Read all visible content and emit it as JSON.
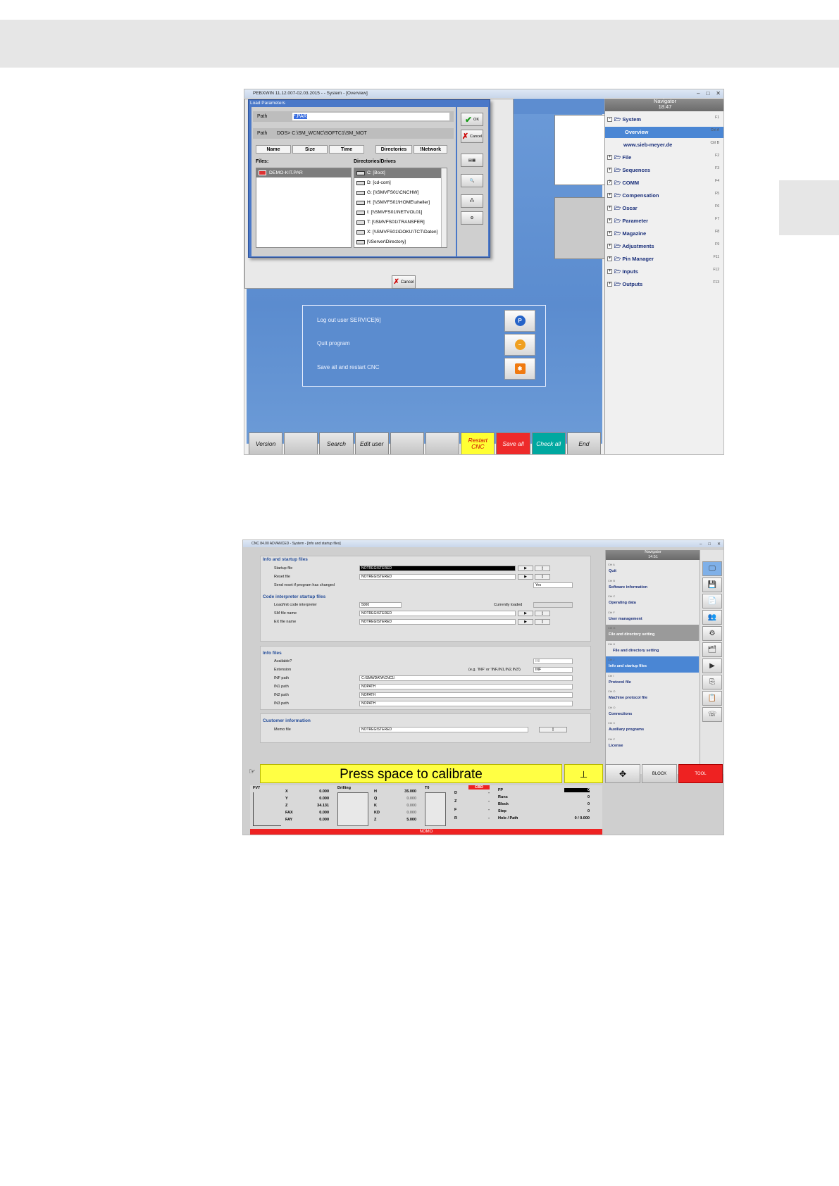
{
  "shot1": {
    "window_title": "PEBXWIN 11.12.007-02.03.2015 -  - System - [Overview]",
    "dialog": {
      "title": "Load Parameters",
      "path_label": "Path",
      "path_value": "*.PAR",
      "dos_label": "Path",
      "dos_value": "DOS> C:\\SM_WCNC\\SOFTC1\\SM_MOT",
      "columns": [
        "Name",
        "Size",
        "Time",
        "Directories",
        "!Network"
      ],
      "files_label": "Files:",
      "drives_label": "Directories/Drives",
      "files": [
        "DEMO-KIT.PAR"
      ],
      "drives": [
        "C: [Boot]",
        "D: [cd-com]",
        "G: [\\\\SMVFS01\\CNCHW]",
        "H: [\\\\SMVFS01\\HOME\\uheller]",
        "I: [\\\\SMVFS01\\NETVOL01]",
        "T: [\\\\SMVFS01\\TRANSFER]",
        "X: [\\\\SMVFS01\\DOKU\\TCT\\Daten]",
        "[\\\\Server\\Directory]"
      ],
      "ok_label": "OK",
      "cancel_label": "Cancel",
      "outer_cancel_label": "Cancel"
    },
    "panel": {
      "logout": "Log out user SERVICE[6]",
      "quit": "Quit program",
      "save": "Save all and restart CNC"
    },
    "fkeys": [
      "Version",
      "",
      "Search",
      "Edit user",
      "",
      "",
      "Restart CNC",
      "Save all",
      "Check all",
      "End"
    ],
    "fkey_colors": [
      "",
      "",
      "",
      "",
      "",
      "",
      "#ffff33",
      "#ee2a2a",
      "#00a8a0",
      ""
    ],
    "navigator": {
      "title": "Navigator",
      "time": "18:47",
      "items": [
        {
          "label": "System",
          "key": "F1",
          "type": "folder",
          "exp": "-"
        },
        {
          "label": "Overview",
          "key": "Ctrl A",
          "type": "selected",
          "exp": ""
        },
        {
          "label": "www.sieb-meyer.de",
          "key": "Ctrl B",
          "type": "link",
          "exp": ""
        },
        {
          "label": "File",
          "key": "F2",
          "type": "folder",
          "exp": "+"
        },
        {
          "label": "Sequences",
          "key": "F3",
          "type": "folder",
          "exp": "+"
        },
        {
          "label": "COMM",
          "key": "F4",
          "type": "folder",
          "exp": "?"
        },
        {
          "label": "Compensation",
          "key": "F5",
          "type": "folder",
          "exp": "+"
        },
        {
          "label": "Oscar",
          "key": "F6",
          "type": "folder",
          "exp": "+"
        },
        {
          "label": "Parameter",
          "key": "F7",
          "type": "folder",
          "exp": "+"
        },
        {
          "label": "Magazine",
          "key": "F8",
          "type": "folder",
          "exp": "+"
        },
        {
          "label": "Adjustments",
          "key": "F9",
          "type": "folder",
          "exp": "+"
        },
        {
          "label": "Pin Manager",
          "key": "F11",
          "type": "folder",
          "exp": "+"
        },
        {
          "label": "Inputs",
          "key": "F12",
          "type": "folder",
          "exp": "+"
        },
        {
          "label": "Outputs",
          "key": "F13",
          "type": "folder",
          "exp": "+"
        }
      ]
    }
  },
  "shot2": {
    "window_title": "CNC 84.00 ADVANCED - System - [Info and startup files]",
    "sections": {
      "info_startup": "Info and startup files",
      "code_interp": "Code interpreter startup files",
      "info_files": "Info files",
      "customer": "Customer information"
    },
    "fields": {
      "startup_file": {
        "label": "Startup file",
        "value": "NOTREGISTERED"
      },
      "reset_file": {
        "label": "Reset file",
        "value": "NOTREGISTERED"
      },
      "send_reset": {
        "label": "Send reset if program has changed",
        "value": "Yes"
      },
      "load_init": {
        "label": "Load/init code interpreter",
        "value": "5000"
      },
      "currently_loaded": "Currently loaded",
      "sm_file": {
        "label": "SM file name",
        "value": "NOTREGISTERED"
      },
      "ex_file": {
        "label": "EX file name",
        "value": "NOTREGISTERED"
      },
      "available": {
        "label": "Available?",
        "value": "INI"
      },
      "extension": {
        "label": "Extension",
        "hint": "(e.g. 'INF' or 'INF,IN1,IN2,IN3')",
        "value": "INF"
      },
      "inf_path": {
        "label": "INF path",
        "value": "C:\\SMWDATA\\CNC1\\"
      },
      "in1_path": {
        "label": "IN1 path",
        "value": "NOPATH"
      },
      "in2_path": {
        "label": "IN2 path",
        "value": "NOPATH"
      },
      "in3_path": {
        "label": "IN3 path",
        "value": "NOPATH"
      },
      "memo_file": {
        "label": "Memo file",
        "value": "NOTREGISTERED"
      }
    },
    "navigator": {
      "title": "Navigator",
      "time": "14:51",
      "items": [
        {
          "ctl": "Ctrl A",
          "label": "Quit"
        },
        {
          "ctl": "Ctrl B",
          "label": "Software information"
        },
        {
          "ctl": "Ctrl C",
          "label": "Operating data"
        },
        {
          "ctl": "Ctrl F",
          "label": "User management"
        },
        {
          "ctl": "Ctrl G",
          "label": "File and directory setting"
        },
        {
          "ctl": "Ctrl H",
          "label": "File and directory setting"
        },
        {
          "ctl": "Ctrl J",
          "label": "Info and startup files"
        },
        {
          "ctl": "Ctrl I",
          "label": "Protocol file"
        },
        {
          "ctl": "Ctrl O",
          "label": "Machine protocol file"
        },
        {
          "ctl": "Ctrl O",
          "label": "Connections"
        },
        {
          "ctl": "Ctrl X",
          "label": "Auxiliary programs"
        },
        {
          "ctl": "Ctrl Z",
          "label": "License"
        }
      ]
    },
    "calibrate": "Press space to calibrate",
    "bottom_buttons": [
      "BLOCK",
      "TOOL"
    ],
    "status": {
      "fv7": "FV7",
      "axes": [
        {
          "n": "X",
          "v": "0.000"
        },
        {
          "n": "Y",
          "v": "0.000"
        },
        {
          "n": "Z",
          "v": "34.131"
        },
        {
          "n": "FAX",
          "v": "0.000"
        },
        {
          "n": "FAY",
          "v": "0.000"
        }
      ],
      "drilling": "Drilling",
      "drill": [
        {
          "n": "H",
          "v": "35.000"
        },
        {
          "n": "Q",
          "v": "0.000"
        },
        {
          "n": "K",
          "v": "0.000"
        },
        {
          "n": "KD",
          "v": "0.000"
        },
        {
          "n": "Z",
          "v": "5.000"
        }
      ],
      "t0": "T0",
      "cbd": "CBD",
      "tool": [
        {
          "n": "D",
          "v": "-"
        },
        {
          "n": "Z",
          "v": "-"
        },
        {
          "n": "F",
          "v": "-"
        },
        {
          "n": "R",
          "v": "-"
        }
      ],
      "info": [
        {
          "n": "FP",
          "v": "0"
        },
        {
          "n": "Runs",
          "v": "0"
        },
        {
          "n": "Block",
          "v": "0"
        },
        {
          "n": "Step",
          "v": "0"
        },
        {
          "n": "Hole / Path",
          "v": "0 / 0.000"
        }
      ],
      "nomo": "NOMO"
    }
  }
}
